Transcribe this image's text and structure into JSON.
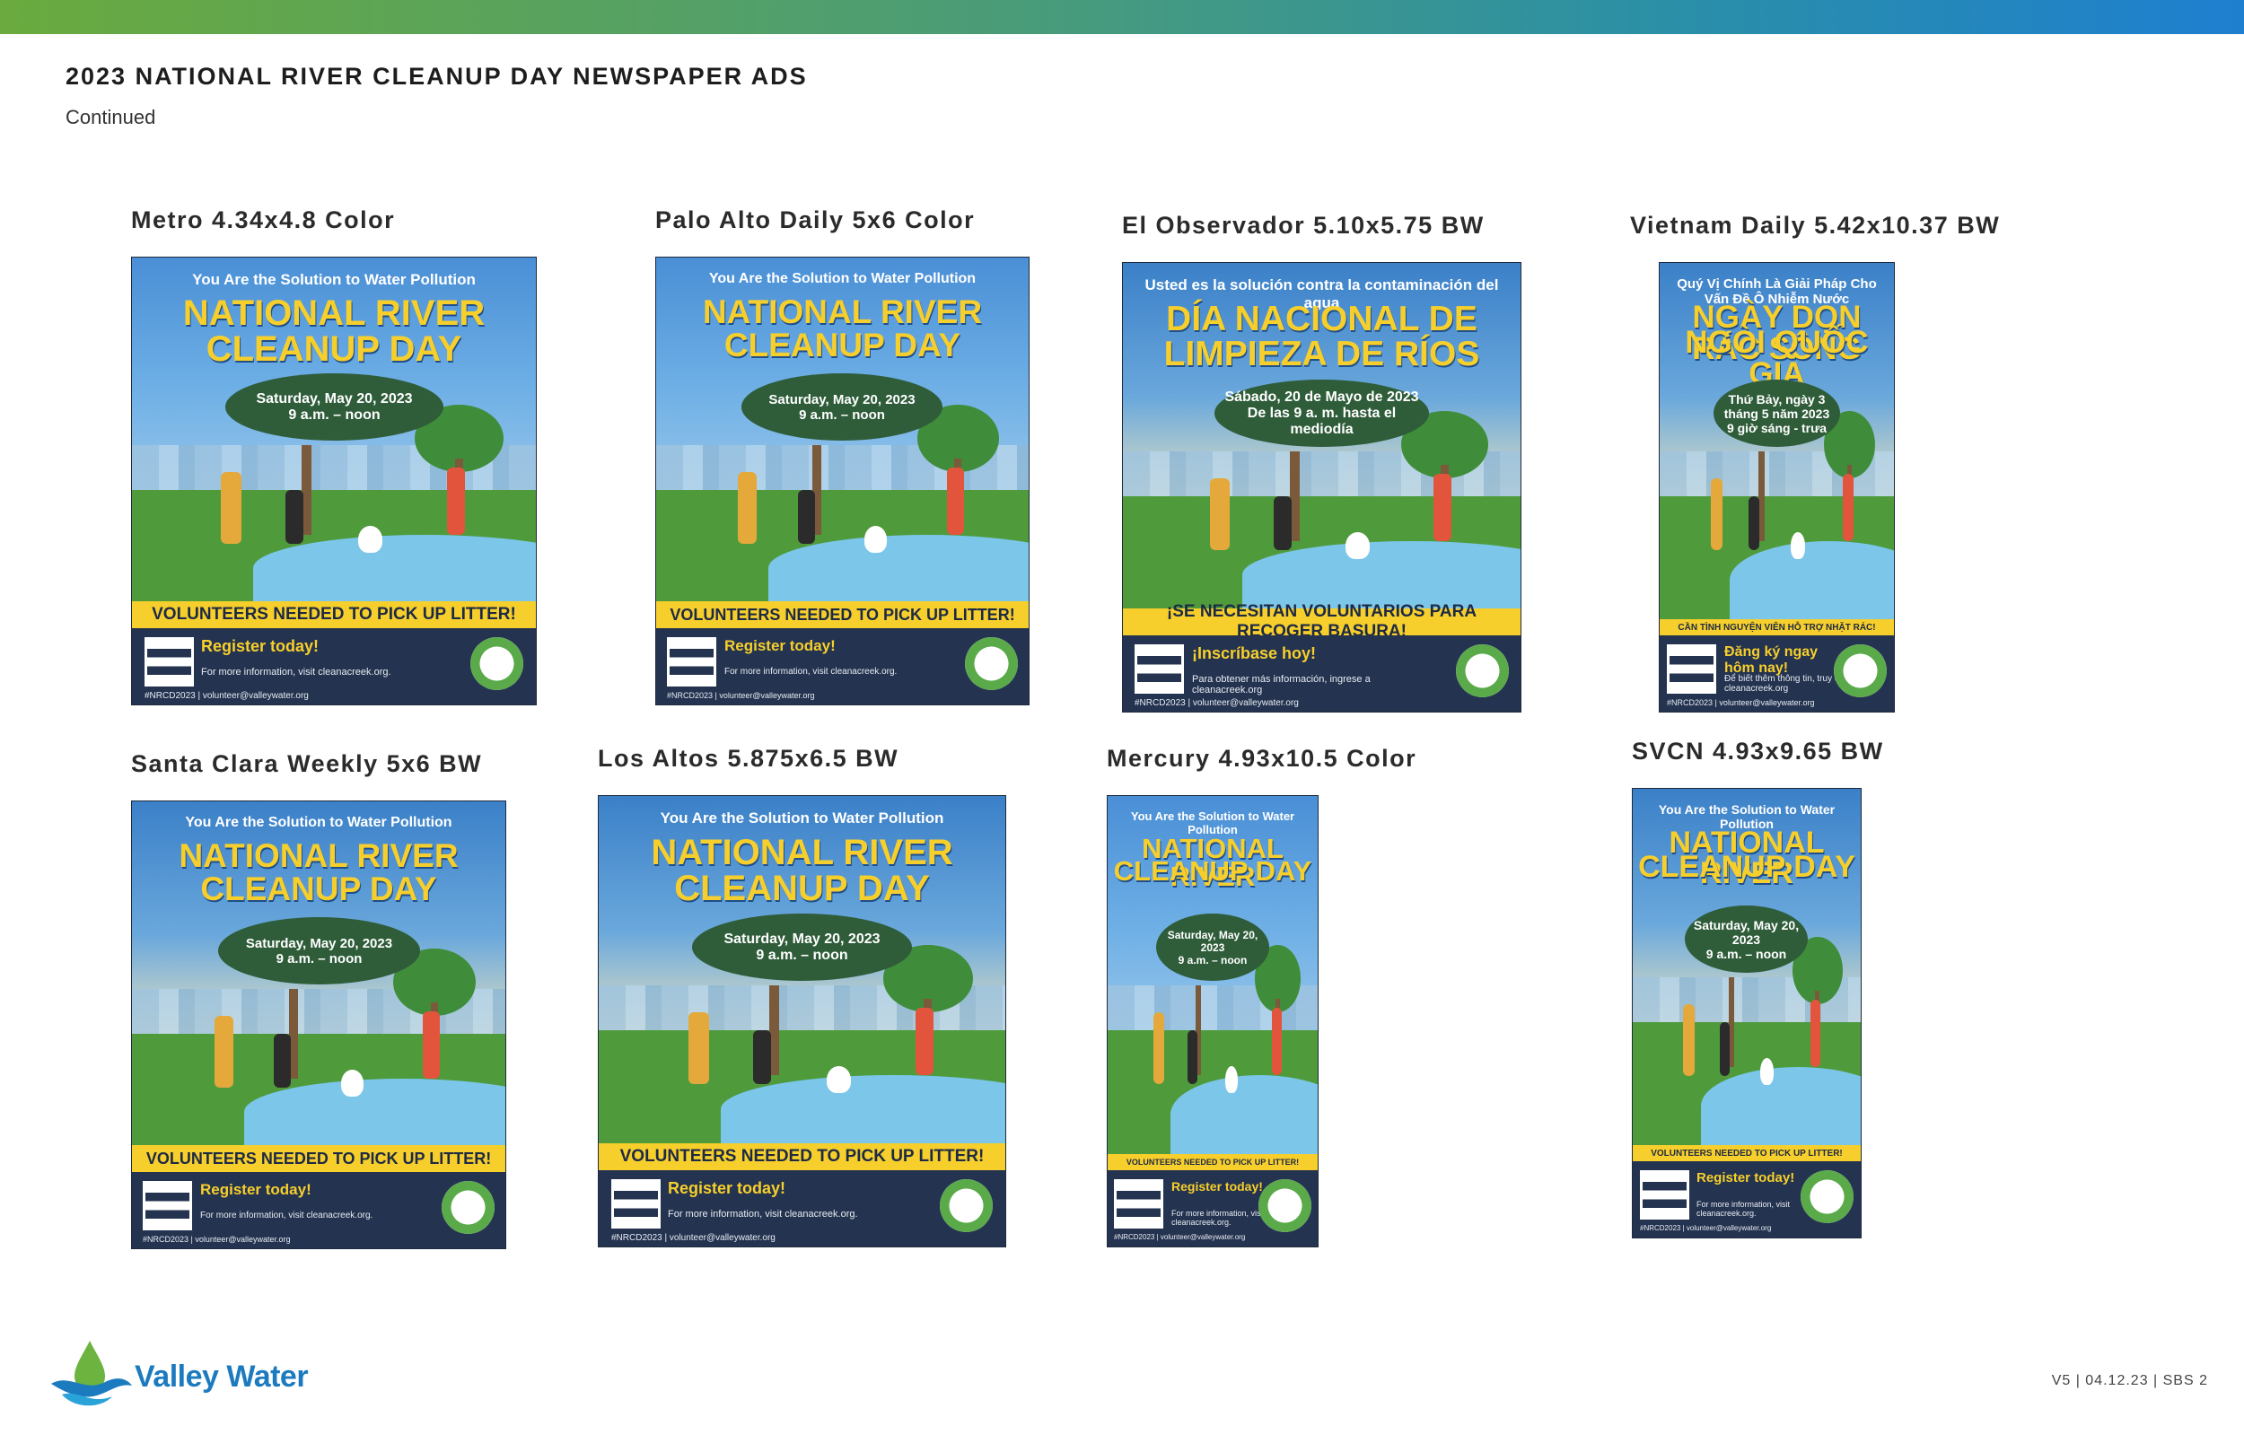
{
  "header": {
    "title": "2023 NATIONAL RIVER CLEANUP DAY NEWSPAPER ADS",
    "subtitle": "Continued"
  },
  "ads": [
    {
      "label": "Metro 4.34x4.8 Color",
      "tagline": "You Are the Solution to Water Pollution",
      "headline_1": "NATIONAL RIVER",
      "headline_2": "CLEANUP DAY",
      "date": "Saturday, May 20, 2023",
      "time": "9 a.m. – noon",
      "volunteers": "VOLUNTEERS NEEDED TO PICK UP LITTER!",
      "register": "Register today!",
      "info_1": "For more information, visit cleanacreek.org.",
      "info_2": "#NRCD2023 | volunteer@valleywater.org"
    },
    {
      "label": "Palo Alto Daily 5x6 Color",
      "tagline": "You Are the Solution to Water Pollution",
      "headline_1": "NATIONAL RIVER",
      "headline_2": "CLEANUP DAY",
      "date": "Saturday, May 20, 2023",
      "time": "9 a.m. – noon",
      "volunteers": "VOLUNTEERS NEEDED TO PICK UP LITTER!",
      "register": "Register today!",
      "info_1": "For more information, visit cleanacreek.org.",
      "info_2": "#NRCD2023 | volunteer@valleywater.org"
    },
    {
      "label": "El Observador 5.10x5.75 BW",
      "tagline": "Usted es la solución contra la contaminación del agua",
      "headline_1": "DÍA NACIONAL DE",
      "headline_2": "LIMPIEZA DE RÍOS",
      "date": "Sábado, 20 de Mayo de 2023",
      "time": "De las 9 a. m. hasta el mediodía",
      "volunteers": "¡SE NECESITAN VOLUNTARIOS PARA RECOGER BASURA!",
      "register": "¡Inscríbase hoy!",
      "info_1": "Para obtener más información, ingrese a cleanacreek.org",
      "info_2": "#NRCD2023 | volunteer@valleywater.org"
    },
    {
      "label": "Vietnam Daily 5.42x10.37 BW",
      "tagline": "Quý Vị Chính Là Giải Pháp Cho Vấn Đề Ô Nhiễm Nước",
      "headline_1": "NGÀY DỌN RÁC SÔNG",
      "headline_2": "NGÒI QUỐC GIA",
      "date": "Thứ Bảy, ngày 3 tháng 5 năm 2023",
      "time": "9 giờ sáng - trưa",
      "volunteers": "CẦN TÌNH NGUYỆN VIÊN HỖ TRỢ NHẶT RÁC!",
      "register": "Đăng ký ngay hôm nay!",
      "info_1": "Để biết thêm thông tin, truy cập cleanacreek.org",
      "info_2": "#NRCD2023 | volunteer@valleywater.org"
    },
    {
      "label": "Santa Clara Weekly 5x6 BW",
      "tagline": "You Are the Solution to Water Pollution",
      "headline_1": "NATIONAL RIVER",
      "headline_2": "CLEANUP DAY",
      "date": "Saturday, May 20, 2023",
      "time": "9 a.m. – noon",
      "volunteers": "VOLUNTEERS NEEDED TO PICK UP LITTER!",
      "register": "Register today!",
      "info_1": "For more information, visit cleanacreek.org.",
      "info_2": "#NRCD2023 | volunteer@valleywater.org"
    },
    {
      "label": "Los Altos 5.875x6.5 BW",
      "tagline": "You Are the Solution to Water Pollution",
      "headline_1": "NATIONAL RIVER",
      "headline_2": "CLEANUP DAY",
      "date": "Saturday, May 20, 2023",
      "time": "9 a.m. – noon",
      "volunteers": "VOLUNTEERS NEEDED TO PICK UP LITTER!",
      "register": "Register today!",
      "info_1": "For more information, visit cleanacreek.org.",
      "info_2": "#NRCD2023 | volunteer@valleywater.org"
    },
    {
      "label": "Mercury 4.93x10.5 Color",
      "tagline": "You Are the Solution to Water Pollution",
      "headline_1": "NATIONAL RIVER",
      "headline_2": "CLEANUP DAY",
      "date": "Saturday, May 20, 2023",
      "time": "9 a.m. – noon",
      "volunteers": "VOLUNTEERS NEEDED TO PICK UP LITTER!",
      "register": "Register today!",
      "info_1": "For more information, visit cleanacreek.org.",
      "info_2": "#NRCD2023 | volunteer@valleywater.org"
    },
    {
      "label": "SVCN 4.93x9.65 BW",
      "tagline": "You Are the Solution to Water Pollution",
      "headline_1": "NATIONAL RIVER",
      "headline_2": "CLEANUP DAY",
      "date": "Saturday, May 20, 2023",
      "time": "9 a.m. – noon",
      "volunteers": "VOLUNTEERS NEEDED TO PICK UP LITTER!",
      "register": "Register today!",
      "info_1": "For more information, visit cleanacreek.org.",
      "info_2": "#NRCD2023 | volunteer@valleywater.org"
    }
  ],
  "logo": {
    "text": "Valley Water"
  },
  "footer": {
    "text": "V5  |  04.12.23  |  SBS      2"
  }
}
